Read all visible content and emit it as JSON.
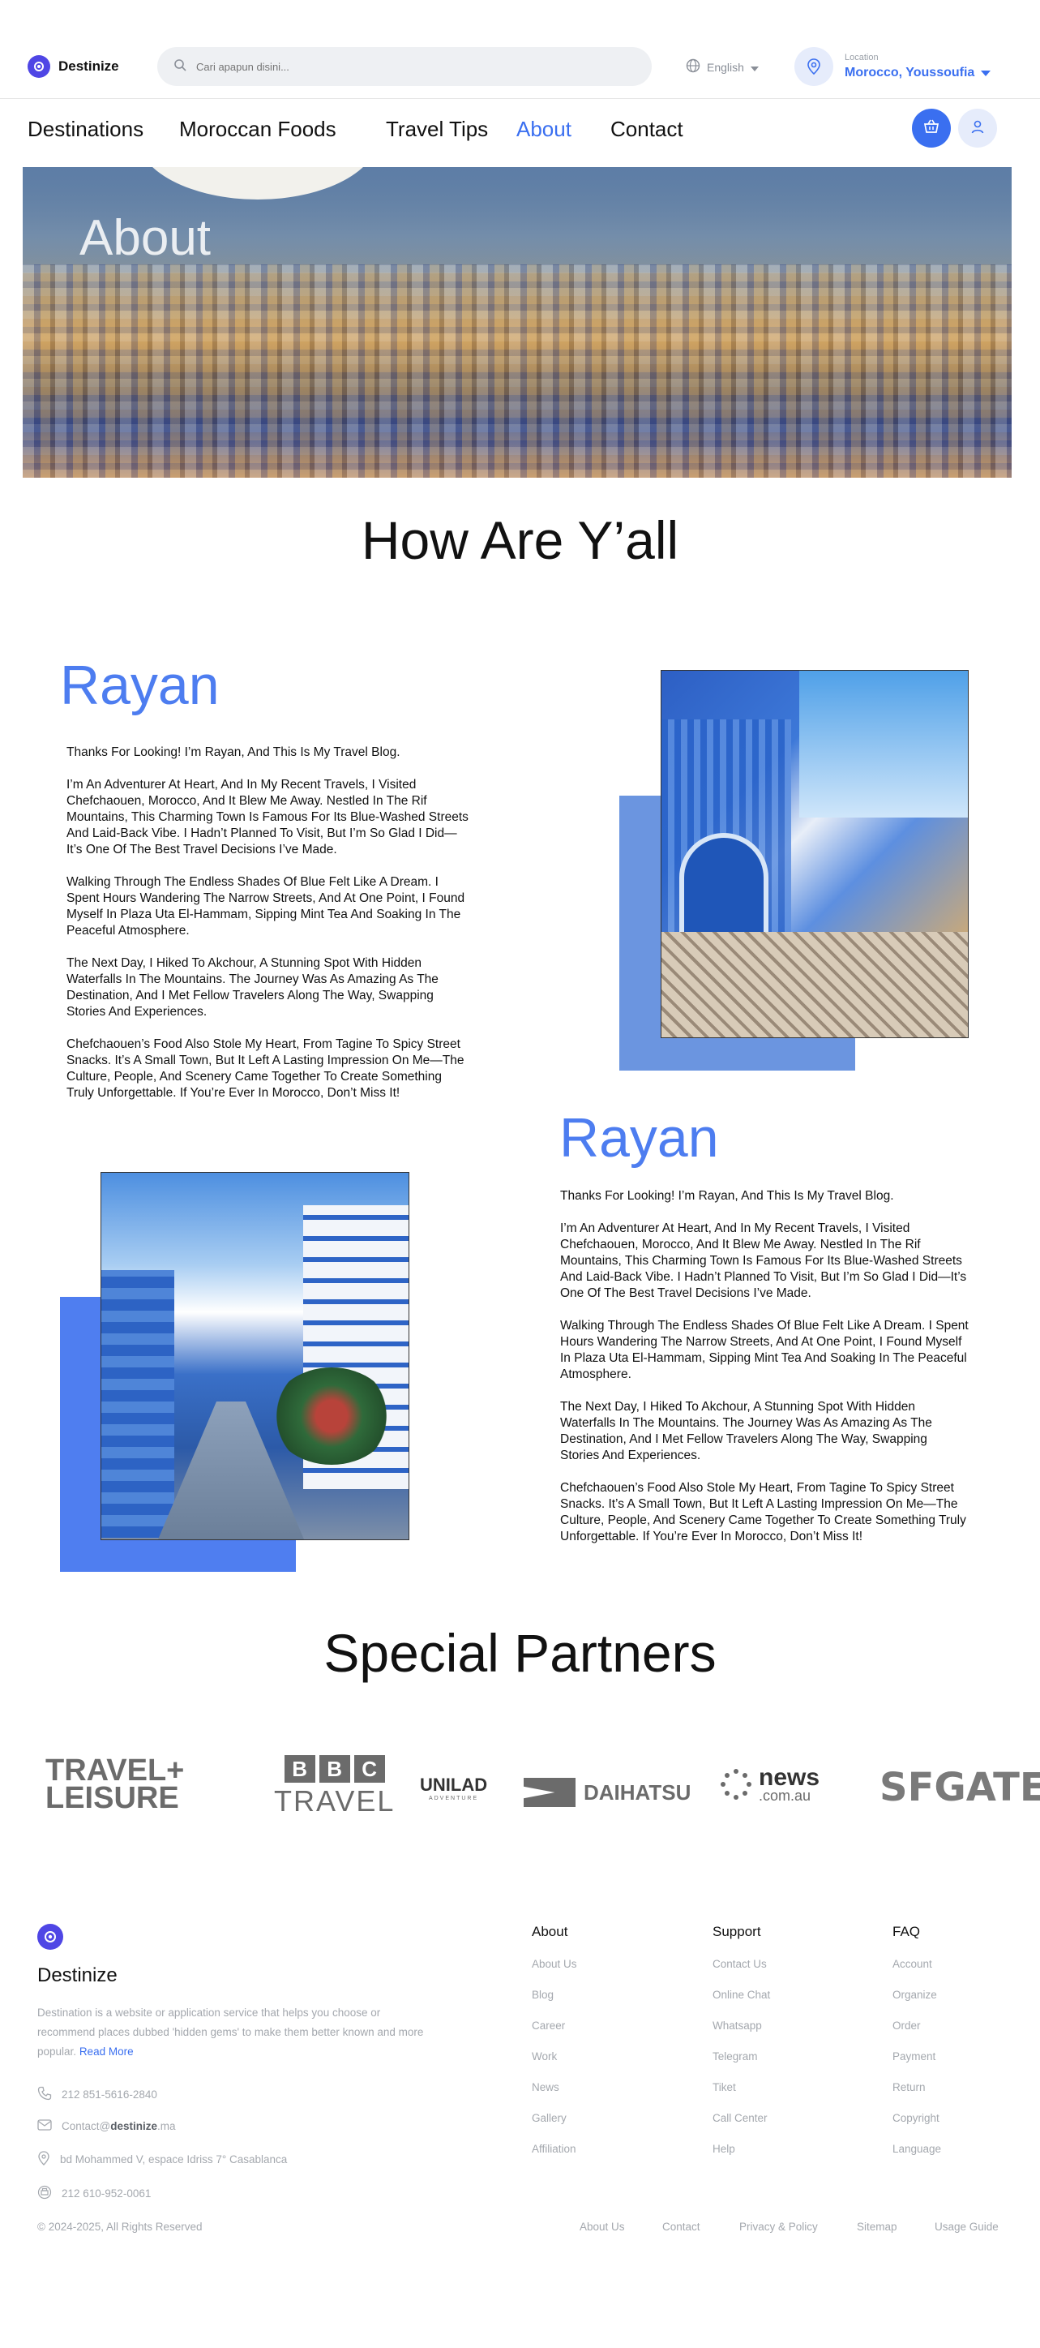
{
  "header": {
    "brand": "Destinize",
    "search_placeholder": "Cari apapun disini...",
    "language": "English",
    "location_label": "Location",
    "location_value": "Morocco, Youssoufia"
  },
  "nav": {
    "items": [
      "Destinations",
      "Moroccan Foods",
      "Travel Tips",
      "About",
      "Contact"
    ],
    "active": "About"
  },
  "hero": {
    "title": "About"
  },
  "section_heading": "How Are Y’all",
  "blog": [
    {
      "name": "Rayan",
      "paragraphs": [
        "Thanks For Looking! I’m Rayan, And This Is My Travel Blog.",
        "I’m An Adventurer At Heart, And In My Recent Travels, I Visited Chefchaouen, Morocco, And It Blew Me Away. Nestled In The Rif Mountains, This Charming Town Is Famous For Its Blue-Washed Streets And Laid-Back Vibe. I Hadn’t Planned To Visit, But I’m So Glad I Did—It’s One Of The Best Travel Decisions I’ve Made.",
        "Walking Through The Endless Shades Of Blue Felt Like A Dream. I Spent Hours Wandering The Narrow Streets, And At One Point, I Found Myself In Plaza Uta El-Hammam, Sipping Mint Tea And Soaking In The Peaceful Atmosphere.",
        "The Next Day, I Hiked To Akchour, A Stunning Spot With Hidden Waterfalls In The Mountains. The Journey Was As Amazing As The Destination, And I Met Fellow Travelers Along The Way, Swapping Stories And Experiences.",
        "Chefchaouen’s Food Also Stole My Heart, From Tagine To Spicy Street Snacks. It’s A Small Town, But It Left A Lasting Impression On Me—The Culture, People, And Scenery Came Together To Create Something Truly Unforgettable. If You’re Ever In Morocco, Don’t Miss It!"
      ]
    },
    {
      "name": "Rayan",
      "paragraphs": [
        "Thanks For Looking! I’m Rayan, And This Is My Travel Blog.",
        "I’m An Adventurer At Heart, And In My Recent Travels, I Visited Chefchaouen, Morocco, And It Blew Me Away. Nestled In The Rif Mountains, This Charming Town Is Famous For Its Blue-Washed Streets And Laid-Back Vibe. I Hadn’t Planned To Visit, But I’m So Glad I Did—It’s One Of The Best Travel Decisions I’ve Made.",
        "Walking Through The Endless Shades Of Blue Felt Like A Dream. I Spent Hours Wandering The Narrow Streets, And At One Point, I Found Myself In Plaza Uta El-Hammam, Sipping Mint Tea And Soaking In The Peaceful Atmosphere.",
        "The Next Day, I Hiked To Akchour, A Stunning Spot With Hidden Waterfalls In The Mountains. The Journey Was As Amazing As The Destination, And I Met Fellow Travelers Along The Way, Swapping Stories And Experiences.",
        "Chefchaouen’s Food Also Stole My Heart, From Tagine To Spicy Street Snacks. It’s A Small Town, But It Left A Lasting Impression On Me—The Culture, People, And Scenery Came Together To Create Something Truly Unforgettable. If You’re Ever In Morocco, Don’t Miss It!"
      ]
    }
  ],
  "partners": {
    "heading": "Special Partners",
    "logos": [
      {
        "line1": "TRAVEL+",
        "line2": "LEISURE"
      },
      {
        "line1": "BBC",
        "line2": "TRAVEL"
      },
      {
        "line1": "UNILAD",
        "line2": "ADVENTURE"
      },
      {
        "line1": "DAIHATSU",
        "line2": ""
      },
      {
        "line1": "news",
        "line2": ".com.au"
      },
      {
        "line1": "SFGATE",
        "line2": ""
      }
    ]
  },
  "footer": {
    "brand": "Destinize",
    "description": "Destination is a website or application service that helps you choose or recommend places dubbed 'hidden gems' to make them better known and more popular.",
    "read_more": "Read More",
    "phone": "212 851-5616-2840",
    "email_prefix": "Contact@",
    "email_domain": "destinize",
    "email_suffix": ".ma",
    "address": "bd Mohammed V, espace Idriss 7° Casablanca",
    "fax": "212 610-952-0061",
    "columns": [
      {
        "title": "About",
        "items": [
          "About Us",
          "Blog",
          "Career",
          "Work",
          "News",
          "Gallery",
          "Affiliation"
        ]
      },
      {
        "title": "Support",
        "items": [
          "Contact Us",
          "Online Chat",
          "Whatsapp",
          "Telegram",
          "Tiket",
          "Call Center",
          "Help"
        ]
      },
      {
        "title": "FAQ",
        "items": [
          "Account",
          "Organize",
          "Order",
          "Payment",
          "Return",
          "Copyright",
          "Language"
        ]
      }
    ],
    "copyright": "© 2024-2025, All Rights Reserved",
    "bottom_links": [
      "About Us",
      "Contact",
      "Privacy & Policy",
      "Sitemap",
      "Usage Guide"
    ]
  },
  "colors": {
    "accent": "#3a6ff0",
    "name_blue": "#4d7df0",
    "photo_block": "#6b95e0",
    "brand_purple": "#4f46e5"
  }
}
